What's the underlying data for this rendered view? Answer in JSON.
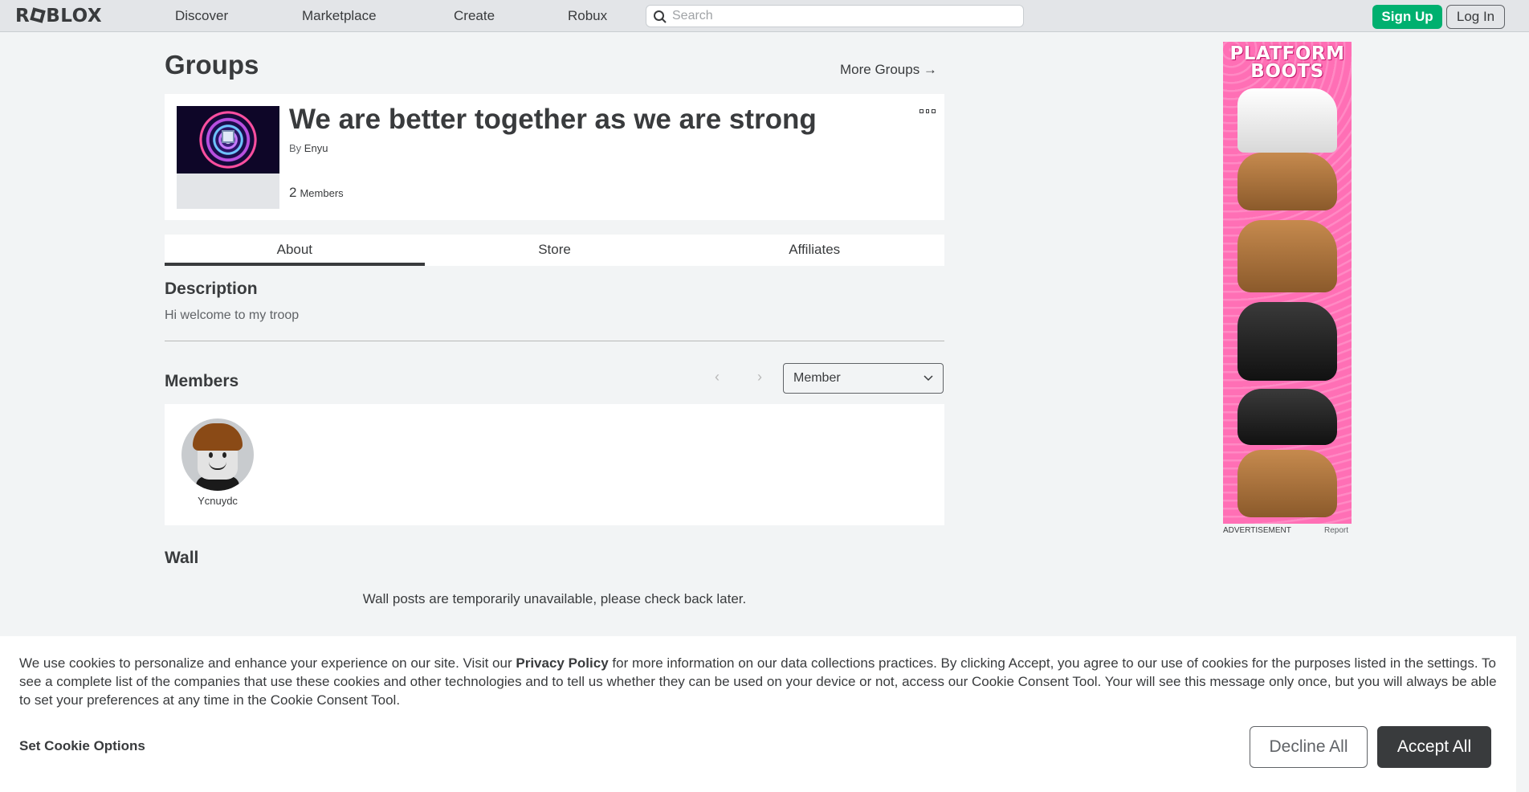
{
  "nav": {
    "logo": "ROBLOX",
    "links": [
      "Discover",
      "Marketplace",
      "Create",
      "Robux"
    ],
    "search_placeholder": "Search",
    "signup": "Sign Up",
    "login": "Log In"
  },
  "page": {
    "title": "Groups",
    "more_groups": "More Groups →"
  },
  "group": {
    "name": "We are better together as we are strong",
    "by_label": "By",
    "owner": "Enyu",
    "member_count": "2",
    "members_label": "Members"
  },
  "tabs": [
    {
      "label": "About",
      "active": true
    },
    {
      "label": "Store",
      "active": false
    },
    {
      "label": "Affiliates",
      "active": false
    }
  ],
  "description": {
    "heading": "Description",
    "text": "Hi welcome to my troop"
  },
  "members": {
    "heading": "Members",
    "role_selected": "Member",
    "prev": "‹",
    "next": "›",
    "list": [
      {
        "name": "Ycnuydc"
      }
    ]
  },
  "wall": {
    "heading": "Wall",
    "message": "Wall posts are temporarily unavailable, please check back later."
  },
  "ad": {
    "title_line1": "PLATFORM",
    "title_line2": "BOOTS",
    "label": "ADVERTISEMENT",
    "report": "Report"
  },
  "cookie": {
    "text_before": "We use cookies to personalize and enhance your experience on our site. Visit our ",
    "privacy_link": "Privacy Policy",
    "text_after": " for more information on our data collections practices. By clicking Accept, you agree to our use of cookies for the purposes listed in the settings. To see a complete list of the companies that use these cookies and other technologies and to tell us whether they can be used on your device or not, access our Cookie Consent Tool. Your will see this message only once, but you will always be able to set your preferences at any time in the Cookie Consent Tool.",
    "set_options": "Set Cookie Options",
    "decline": "Decline All",
    "accept": "Accept All"
  },
  "colors": {
    "signup_green": "#00b06f",
    "page_bg": "#f2f4f5",
    "accept_dark": "#393b3d"
  }
}
